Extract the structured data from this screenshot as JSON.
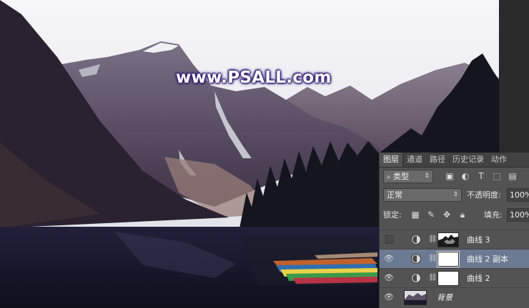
{
  "watermark": "www.PSALL.com",
  "panel": {
    "tabs": [
      {
        "label": "图层",
        "active": true
      },
      {
        "label": "通道"
      },
      {
        "label": "路径"
      },
      {
        "label": "历史记录"
      },
      {
        "label": "动作"
      }
    ],
    "filter": {
      "kind_label": "类型"
    },
    "blend": {
      "mode": "正常",
      "opacity_label": "不透明度:",
      "opacity_value": "100%"
    },
    "lock": {
      "lock_label": "锁定:",
      "fill_label": "填充:",
      "fill_value": "100%"
    },
    "layers": [
      {
        "name": "曲线 3",
        "visible": false,
        "selected": false,
        "type": "adjustment"
      },
      {
        "name": "曲线 2 副本",
        "visible": true,
        "selected": true,
        "type": "adjustment"
      },
      {
        "name": "曲线 2",
        "visible": true,
        "selected": false,
        "type": "adjustment"
      },
      {
        "name": "背景",
        "visible": true,
        "selected": false,
        "type": "image"
      }
    ]
  },
  "colors": {
    "panel_bg": "#535353",
    "selected_layer": "#6b7a93",
    "watermark_glow": "#2a1a6e"
  }
}
